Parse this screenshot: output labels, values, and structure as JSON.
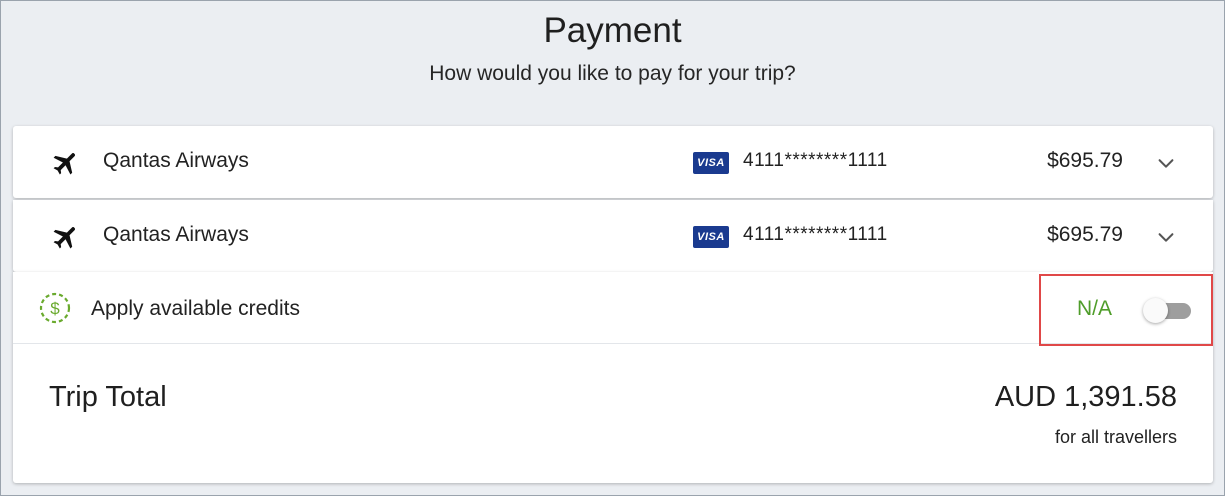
{
  "header": {
    "title": "Payment",
    "subtitle": "How would you like to pay for your trip?"
  },
  "flights": [
    {
      "airline": "Qantas Airways",
      "card_brand": "VISA",
      "card_number": "4111********1111",
      "amount": "$695.79",
      "icon": "plane-icon"
    },
    {
      "airline": "Qantas Airways",
      "card_brand": "VISA",
      "card_number": "4111********1111",
      "amount": "$695.79",
      "icon": "plane-icon"
    }
  ],
  "credits": {
    "label": "Apply available credits",
    "value": "N/A",
    "toggle_on": false,
    "icon": "dollar-circle-icon"
  },
  "total": {
    "label": "Trip Total",
    "amount": "AUD 1,391.58",
    "note": "for all travellers"
  },
  "colors": {
    "background": "#ebeef2",
    "na_green": "#4f9d2a",
    "visa_blue": "#1a3a8f",
    "highlight_red": "#e04848",
    "credit_icon_green": "#6aaa2e"
  }
}
